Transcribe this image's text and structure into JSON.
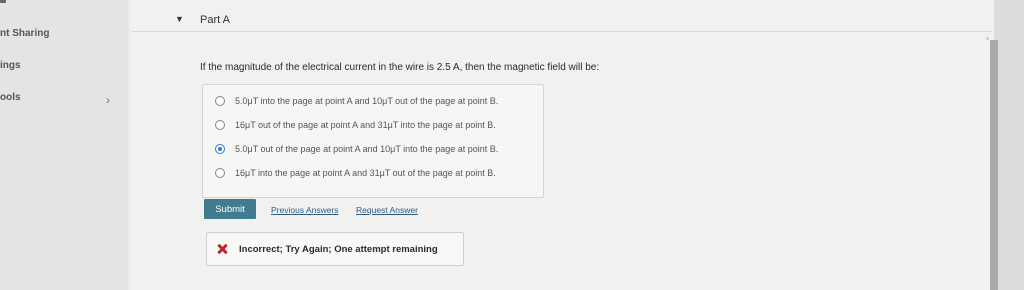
{
  "sidebar": {
    "items": [
      {
        "label": "nt Sharing"
      },
      {
        "label": "ings"
      },
      {
        "label": "ools"
      }
    ],
    "chevron": "›"
  },
  "part": {
    "arrow": "▼",
    "title": "Part A"
  },
  "question": "If the magnitude of the electrical current in the wire is 2.5 A, then the magnetic field will be:",
  "options": [
    {
      "label": "5.0μT into the page at point A and 10μT out of the page at point B.",
      "selected": false
    },
    {
      "label": "16μT out of the page at point A and 31μT into the page at point B.",
      "selected": false
    },
    {
      "label": "5.0μT out of the page at point A and 10μT into the page at point B.",
      "selected": true
    },
    {
      "label": "16μT into the page at point A and 31μT out of the page at point B.",
      "selected": false
    }
  ],
  "actions": {
    "submit_label": "Submit",
    "previous_answers_label": "Previous Answers",
    "request_answer_label": "Request Answer"
  },
  "feedback": {
    "icon": "x-icon",
    "text": "Incorrect; Try Again; One attempt remaining",
    "color": "#c0262d"
  },
  "colors": {
    "submit": "#3f7c8f",
    "link": "#2d5d87",
    "radio_selected": "#2f7fd1"
  }
}
